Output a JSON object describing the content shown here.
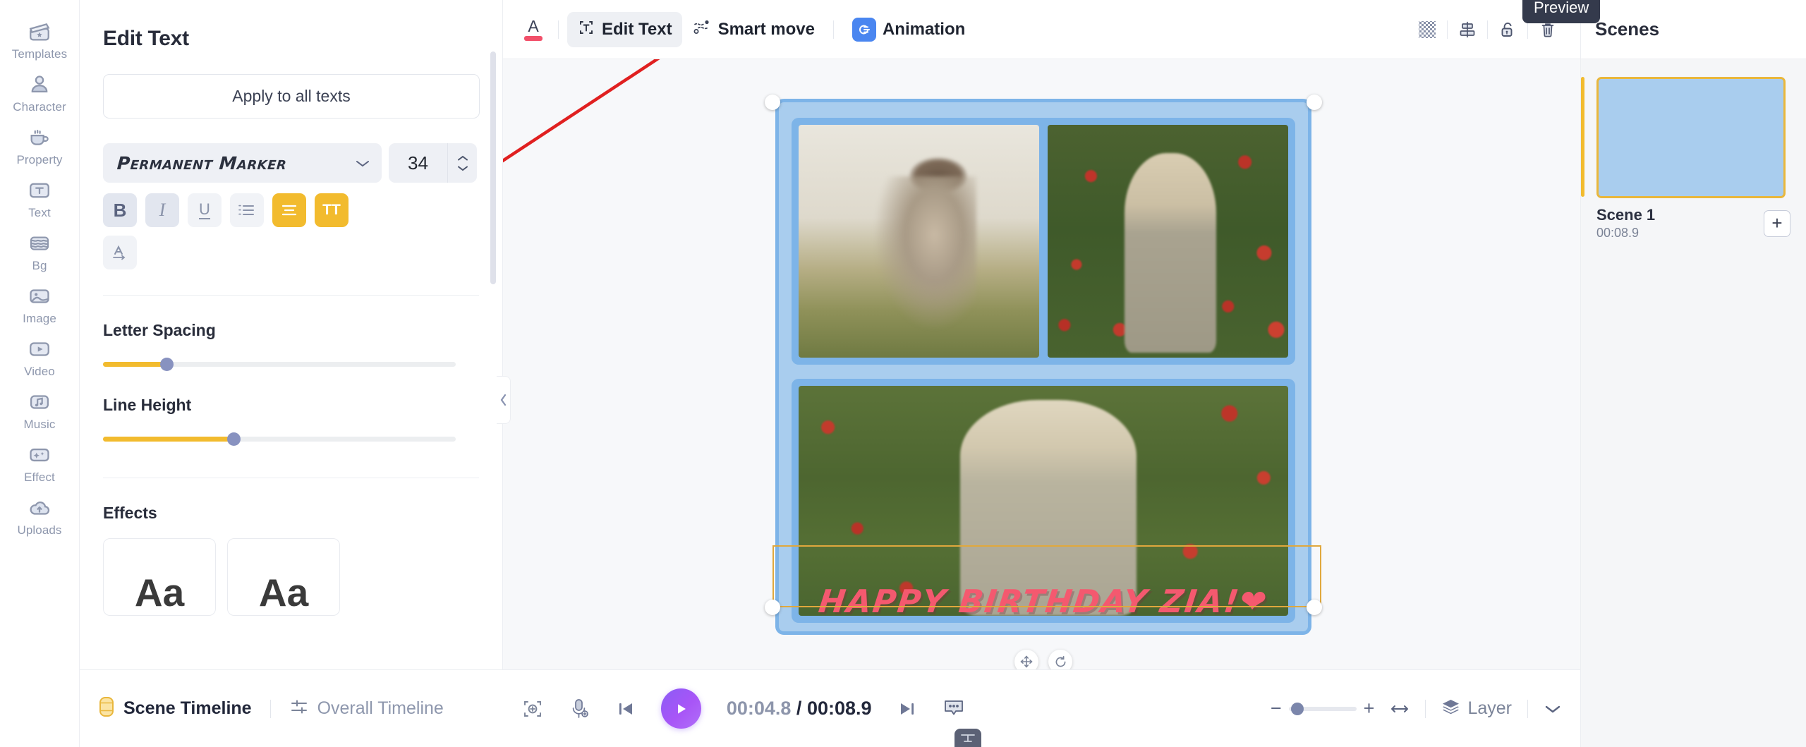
{
  "sidebar": {
    "items": [
      {
        "label": "Templates",
        "icon": "clapperboard-icon"
      },
      {
        "label": "Character",
        "icon": "person-icon"
      },
      {
        "label": "Property",
        "icon": "cup-icon"
      },
      {
        "label": "Text",
        "icon": "text-t-icon"
      },
      {
        "label": "Bg",
        "icon": "layers-wave-icon"
      },
      {
        "label": "Image",
        "icon": "picture-icon"
      },
      {
        "label": "Video",
        "icon": "play-rect-icon"
      },
      {
        "label": "Music",
        "icon": "music-note-icon"
      },
      {
        "label": "Effect",
        "icon": "sparkle-icon"
      },
      {
        "label": "Uploads",
        "icon": "cloud-upload-icon"
      }
    ]
  },
  "panel": {
    "title": "Edit Text",
    "apply_all_label": "Apply to all texts",
    "font_family": "Permanent Marker",
    "font_size": "34",
    "format_buttons": [
      {
        "name": "bold",
        "glyph": "B",
        "state": "on"
      },
      {
        "name": "italic",
        "glyph": "I",
        "state": "on"
      },
      {
        "name": "underline",
        "glyph": "U",
        "state": "off"
      },
      {
        "name": "list",
        "glyph": "≡",
        "state": "off"
      },
      {
        "name": "align-center",
        "glyph": "≡",
        "state": "accent"
      },
      {
        "name": "text-case",
        "glyph": "TT",
        "state": "accent"
      },
      {
        "name": "text-direction",
        "glyph": "A",
        "state": "off"
      }
    ],
    "letter_spacing": {
      "label": "Letter Spacing",
      "percent": 18
    },
    "line_height": {
      "label": "Line Height",
      "percent": 37
    },
    "effects_label": "Effects",
    "effect_cards": [
      {
        "sample": "Aa"
      },
      {
        "sample": "Aa"
      }
    ]
  },
  "toolbar": {
    "text_color_letter": "A",
    "text_color_hex": "#f2506a",
    "tabs": [
      {
        "label": "Edit Text",
        "icon": "text-select-icon",
        "active": true
      },
      {
        "label": "Smart move",
        "icon": "smart-move-icon",
        "active": false
      },
      {
        "label": "Animation",
        "icon": "animation-icon",
        "active": false
      }
    ],
    "right_icons": [
      {
        "name": "transparency-icon"
      },
      {
        "name": "align-icon"
      },
      {
        "name": "unlock-icon"
      },
      {
        "name": "trash-icon"
      }
    ],
    "tooltip": "Preview"
  },
  "canvas": {
    "birthday_text": "HAPPY BIRTHDAY ZIA!❤",
    "selection_color": "#e0a83d",
    "stage_bg_hex": "#a9cdee",
    "frame_bg_hex": "#7db4e8",
    "photos": [
      {
        "name": "photo-mother-and-child"
      },
      {
        "name": "photo-girl-braid-poppies"
      },
      {
        "name": "photo-child-poppy-field"
      }
    ],
    "controls": [
      {
        "name": "move-handle"
      },
      {
        "name": "rotate-handle"
      }
    ]
  },
  "scenes": {
    "title": "Scenes",
    "items": [
      {
        "name": "Scene 1",
        "duration": "00:08.9"
      }
    ],
    "add_label": "+"
  },
  "timeline": {
    "scene_tab": "Scene Timeline",
    "overall_tab": "Overall Timeline",
    "current_time": "00:04.8",
    "time_separator": "/",
    "total_time": "00:08.9",
    "controls": [
      {
        "name": "add-keyframe-icon"
      },
      {
        "name": "microphone-icon"
      },
      {
        "name": "skip-back-icon"
      },
      {
        "name": "play-icon"
      },
      {
        "name": "skip-forward-icon"
      },
      {
        "name": "subtitle-icon"
      }
    ],
    "zoom_out": "−",
    "zoom_in": "+",
    "layer_label": "Layer"
  }
}
